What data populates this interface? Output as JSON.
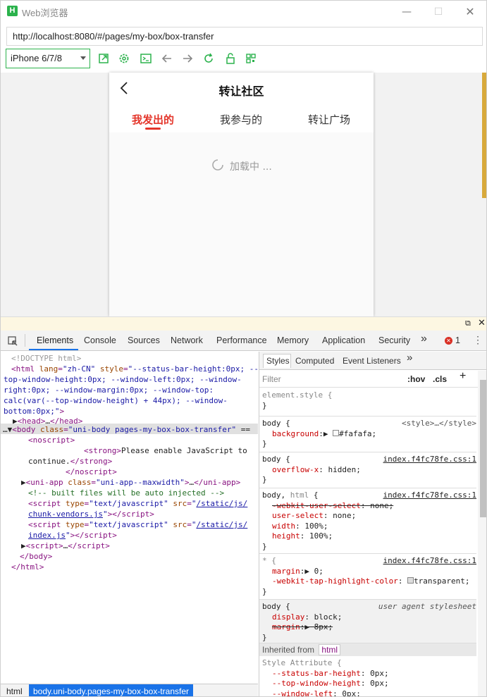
{
  "window": {
    "title": "Web浏览器"
  },
  "url": "http://localhost:8080/#/pages/my-box/box-transfer",
  "device": "iPhone 6/7/8",
  "phone": {
    "title": "转让社区",
    "tabs": [
      "我发出的",
      "我参与的",
      "转让广场"
    ],
    "loading": "加载中 ..."
  },
  "devtools": {
    "tabs": [
      "Elements",
      "Console",
      "Sources",
      "Network",
      "Performance",
      "Memory",
      "Application",
      "Security"
    ],
    "more": "»",
    "errors": "1",
    "styles_tabs": [
      "Styles",
      "Computed",
      "Event Listeners"
    ],
    "filter_placeholder": "Filter",
    "hov": ":hov",
    "cls": ".cls",
    "breadcrumb": [
      "html",
      "body.uni-body.pages-my-box-box-transfer"
    ],
    "inherited_from": "Inherited from",
    "inherited_tag": "html",
    "style_attribute": "Style Attribute {"
  }
}
